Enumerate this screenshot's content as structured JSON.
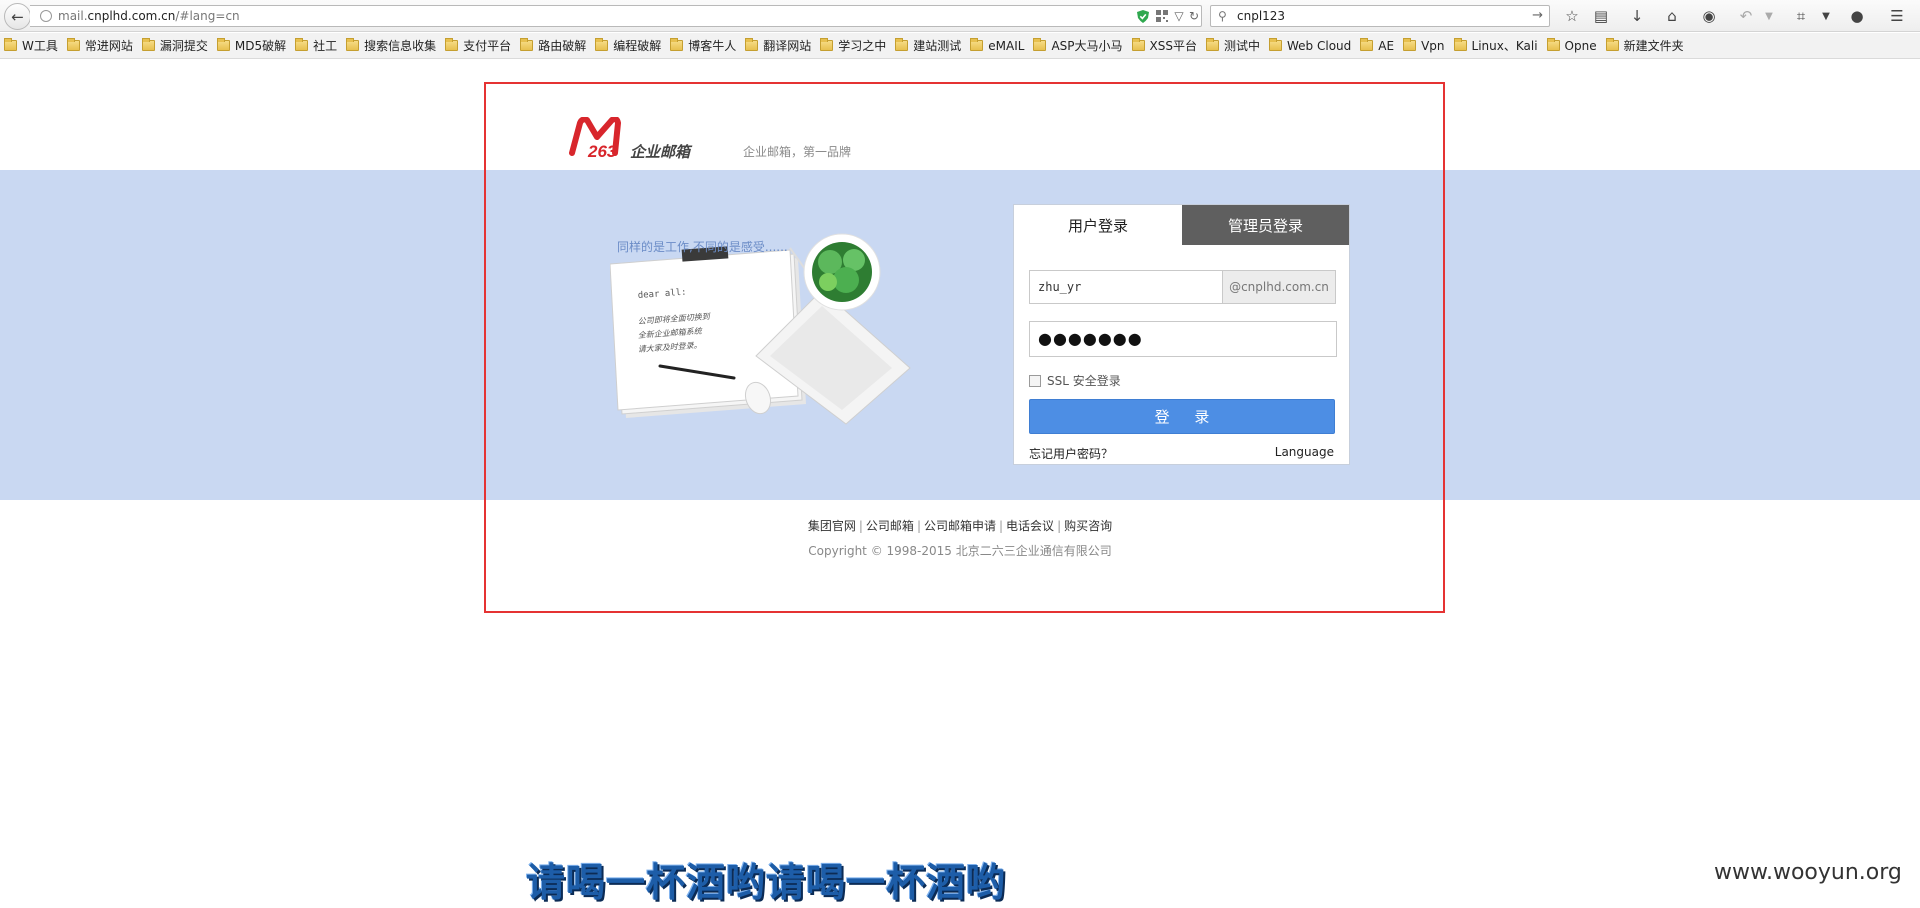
{
  "browser": {
    "url_prefix": "mail.",
    "url_host": "cnplhd.com.cn",
    "url_suffix": "/#lang=cn",
    "search_value": "cnpl123",
    "bookmarks": [
      "W工具",
      "常进网站",
      "漏洞提交",
      "MD5破解",
      "社工",
      "搜索信息收集",
      "支付平台",
      "路由破解",
      "编程破解",
      "博客牛人",
      "翻译网站",
      "学习之中",
      "建站测试",
      "eMAIL",
      "ASP大马小马",
      "XSS平台",
      "测试中",
      "Web Cloud",
      "AE",
      "Vpn",
      "Linux、Kali",
      "Opne",
      "新建文件夹"
    ]
  },
  "header": {
    "slogan": "企业邮箱，第一品牌",
    "logo_number": "263",
    "logo_text": "企业邮箱"
  },
  "illustration": {
    "caption": "同样的是工作,不同的是感受......",
    "note_title": "dear all:",
    "note_lines": [
      "公司即将全面切换到",
      "全新企业邮箱系统",
      "请大家及时登录。"
    ]
  },
  "login": {
    "tab_user": "用户登录",
    "tab_admin": "管理员登录",
    "username_value": "zhu_yr",
    "domain_suffix": "@cnplhd.com.cn",
    "password_mask": "●●●●●●●",
    "ssl_label": "SSL 安全登录",
    "submit_label": "登 录",
    "forgot_link": "忘记用户密码？",
    "language_link": "Language"
  },
  "footer": {
    "links": [
      "集团官网",
      "公司邮箱",
      "公司邮箱申请",
      "电话会议",
      "购买咨询"
    ],
    "separator": "|",
    "copyright": "Copyright © 1998-2015 北京二六三企业通信有限公司"
  },
  "overlay": {
    "caption": "请喝一杯酒哟请喝一杯酒哟",
    "watermark": "www.wooyun.org"
  },
  "colors": {
    "band": "#c9d8f2",
    "frame": "#e53333",
    "button": "#4d8ee4",
    "admin_tab": "#5f5f5f"
  }
}
